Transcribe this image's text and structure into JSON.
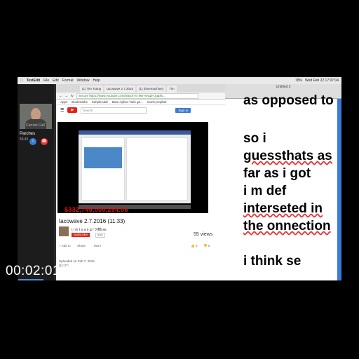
{
  "menubar": {
    "apple": "",
    "app": "TextEdit",
    "items": [
      "File",
      "Edit",
      "Format",
      "Window",
      "Help"
    ],
    "clock": "Wed Feb 22  17:07:04",
    "battery": "78%"
  },
  "facetime": {
    "current_call": "Current Call",
    "caller": "Parches",
    "duration": "53:41"
  },
  "browser": {
    "tabs": [
      "(1) Tim Tsang",
      "tacowave 2.7.2016",
      "(1) (timemachine)",
      "Tim"
    ],
    "url": "Secure  https://www.youtube.com/watch?v=kWYvNqb-Ug&lis...",
    "bookmarks": [
      "Apps",
      "Bookmarks",
      "SimpleAddr",
      "Bare Aphex Twin ga...",
      "monk-prophet"
    ],
    "search_placeholder": "Search",
    "sign_in": "Sign in"
  },
  "video": {
    "overlay_counter": "$332,749,000,294.06",
    "title": "tacowave 2.7.2016 (11:33)",
    "channel": "t i m t s a n g  /  习楠 se.",
    "subscribe": "Subscribe",
    "sub_count": "223",
    "views": "55 views",
    "add_to": "+ Add to",
    "share": "Share",
    "more": "More",
    "likes": "0",
    "dislikes": "0",
    "uploaded": "Uploaded on Feb 7, 2016",
    "uploaded_2": "(11:33)"
  },
  "editor": {
    "title": "Untitled 2",
    "lines": [
      "as opposed to",
      "so i",
      "guessthats as",
      "far as i got",
      "i m def",
      "interseted in",
      "the onnection",
      "",
      "i think se"
    ]
  },
  "overlay": {
    "timecode": "00:02:01;24"
  },
  "colors": {
    "youtube_red": "#e62117",
    "facebook_blue": "#3b5998",
    "spell_underline": "#e33",
    "scrollbar_blue": "#3a7bd5"
  }
}
